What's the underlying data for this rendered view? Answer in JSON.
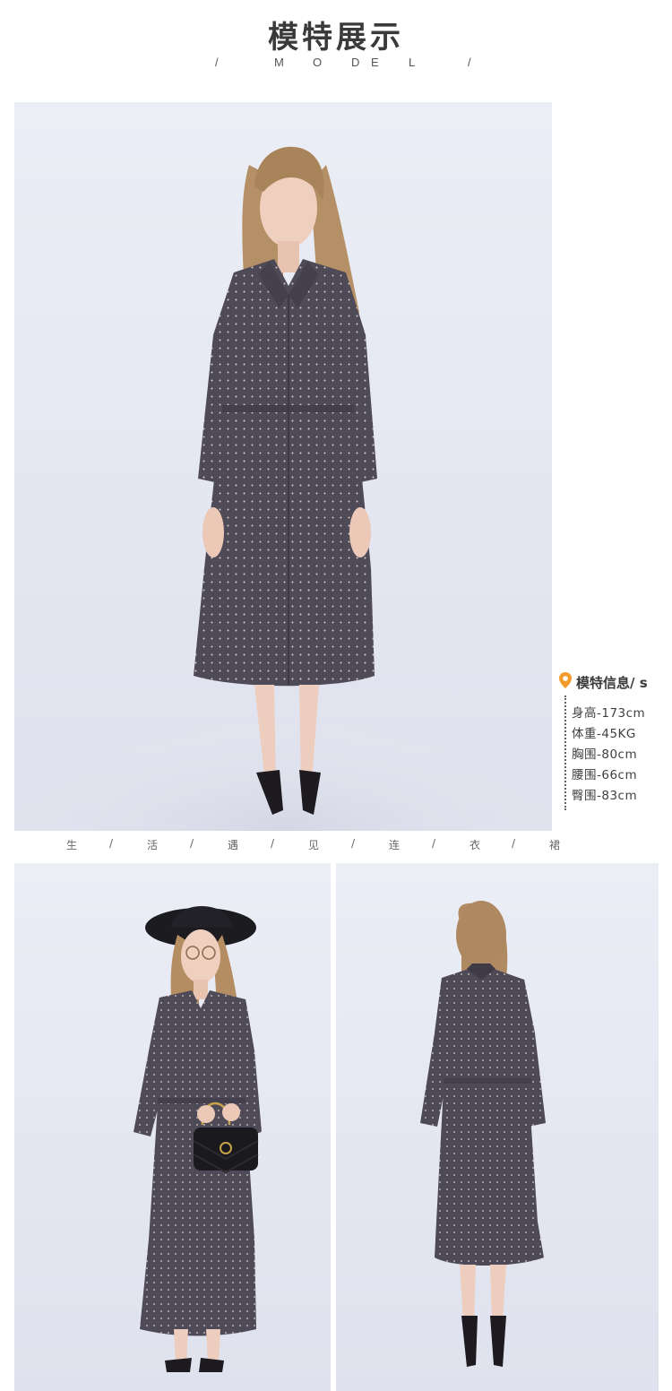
{
  "header": {
    "title": "模特展示",
    "subtitle_letters": [
      "/",
      "M",
      "O",
      "D",
      "E",
      "L",
      "/"
    ]
  },
  "model_info": {
    "title": "模特信息/ s",
    "icon": "location-pin-icon",
    "accent_color": "#f39c2b",
    "items": [
      "身高-173cm",
      "体重-45KG",
      "胸围-80cm",
      "腰围-66cm",
      "臀围-83cm"
    ]
  },
  "caption": {
    "chars": [
      "生",
      "/",
      "活",
      "/",
      "遇",
      "/",
      "见",
      "/",
      "连",
      "/",
      "衣",
      "/",
      "裙"
    ]
  },
  "colors": {
    "background": "#ffffff",
    "dress": "#4f4a58",
    "photo_backdrop": "#e6e8f2"
  }
}
